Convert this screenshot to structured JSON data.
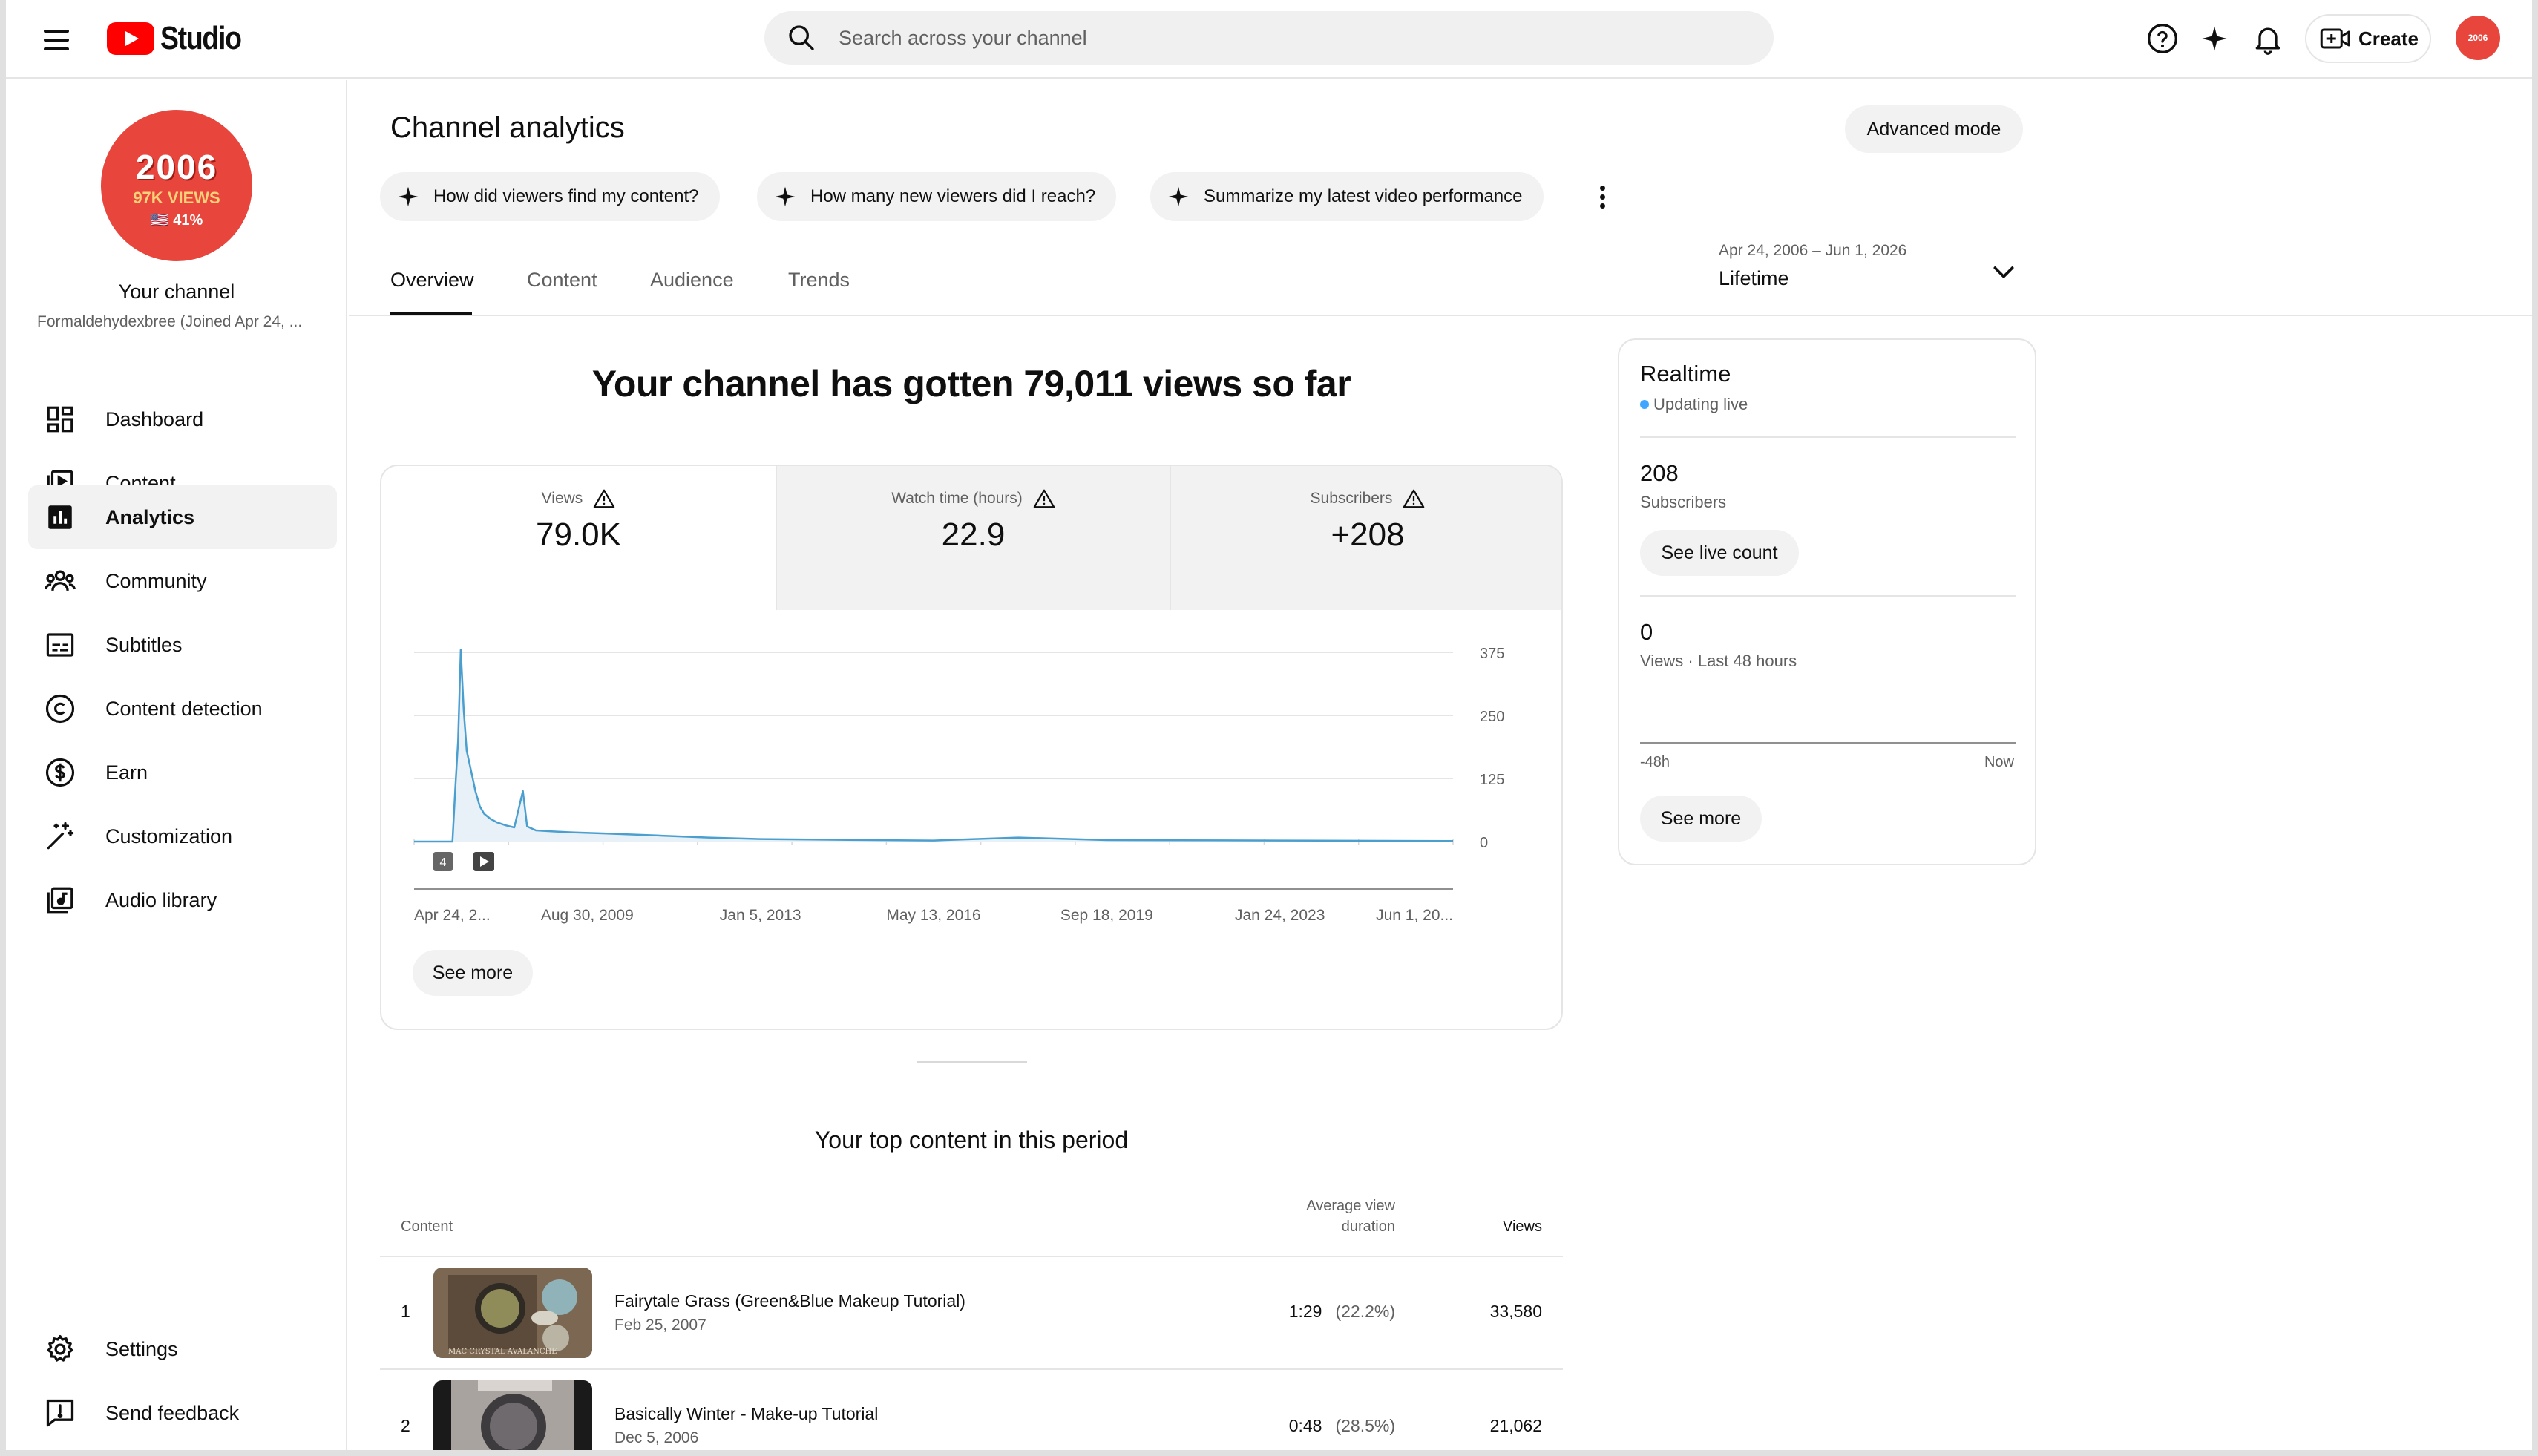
{
  "app": {
    "name": "Studio",
    "avatar_text": "2006"
  },
  "search": {
    "placeholder": "Search across your channel"
  },
  "header": {
    "create_label": "Create"
  },
  "channel": {
    "avatar_year": "2006",
    "avatar_views": "97K VIEWS",
    "avatar_pct": "🇺🇸 41%",
    "name": "Your channel",
    "handle": "Formaldehydexbree (Joined Apr 24, ..."
  },
  "sidebar": {
    "items": [
      {
        "label": "Dashboard",
        "icon": "dashboard-icon"
      },
      {
        "label": "Content",
        "icon": "content-icon"
      },
      {
        "label": "Analytics",
        "icon": "analytics-icon",
        "active": true
      },
      {
        "label": "Community",
        "icon": "community-icon"
      },
      {
        "label": "Subtitles",
        "icon": "subtitles-icon"
      },
      {
        "label": "Content detection",
        "icon": "copyright-icon"
      },
      {
        "label": "Earn",
        "icon": "dollar-icon"
      },
      {
        "label": "Customization",
        "icon": "magic-wand-icon"
      },
      {
        "label": "Audio library",
        "icon": "audio-library-icon"
      }
    ],
    "bottom": [
      {
        "label": "Settings",
        "icon": "gear-icon"
      },
      {
        "label": "Send feedback",
        "icon": "feedback-icon"
      }
    ]
  },
  "main": {
    "title": "Channel analytics",
    "advanced_mode": "Advanced mode",
    "chips": [
      "How did viewers find my content?",
      "How many new viewers did I reach?",
      "Summarize my latest video performance"
    ],
    "tabs": [
      "Overview",
      "Content",
      "Audience",
      "Trends"
    ],
    "date_range": "Apr 24, 2006 – Jun 1, 2026",
    "date_preset": "Lifetime",
    "headline": "Your channel has gotten 79,011 views so far",
    "metrics": [
      {
        "label": "Views",
        "value": "79.0K"
      },
      {
        "label": "Watch time (hours)",
        "value": "22.9"
      },
      {
        "label": "Subscribers",
        "value": "+208"
      }
    ],
    "see_more": "See more",
    "top_content_title": "Your top content in this period",
    "table_headers": {
      "content": "Content",
      "avd_line1": "Average view",
      "avd_line2": "duration",
      "views": "Views"
    },
    "rows": [
      {
        "rank": "1",
        "title": "Fairytale Grass (Green&Blue Makeup Tutorial)",
        "date": "Feb 25, 2007",
        "avd": "1:29",
        "avd_pct": "(22.2%)",
        "views": "33,580",
        "thumb_caption": "MAC CRYSTAL AVALANCHE"
      },
      {
        "rank": "2",
        "title": "Basically Winter - Make-up Tutorial",
        "date": "Dec 5, 2006",
        "avd": "0:48",
        "avd_pct": "(28.5%)",
        "views": "21,062"
      }
    ]
  },
  "chart_data": {
    "type": "area",
    "title": "",
    "x_tick_labels": [
      "Apr 24, 2...",
      "Aug 30, 2009",
      "Jan 5, 2013",
      "May 13, 2016",
      "Sep 18, 2019",
      "Jan 24, 2023",
      "Jun 1, 20..."
    ],
    "y_ticks": [
      0,
      125,
      250,
      375
    ],
    "ylim": [
      0,
      400
    ],
    "x_range": [
      "2006-04-24",
      "2026-06-01"
    ],
    "series": [
      {
        "color": "#4a9fcf",
        "points": [
          [
            "2006-04-24",
            0
          ],
          [
            "2006-12-01",
            0
          ],
          [
            "2007-01-20",
            0
          ],
          [
            "2007-02-10",
            110
          ],
          [
            "2007-03-01",
            200
          ],
          [
            "2007-03-20",
            380
          ],
          [
            "2007-04-10",
            260
          ],
          [
            "2007-05-01",
            180
          ],
          [
            "2007-06-01",
            140
          ],
          [
            "2007-07-01",
            100
          ],
          [
            "2007-08-01",
            70
          ],
          [
            "2007-09-01",
            55
          ],
          [
            "2007-10-15",
            45
          ],
          [
            "2007-12-01",
            38
          ],
          [
            "2008-02-01",
            32
          ],
          [
            "2008-04-01",
            28
          ],
          [
            "2008-06-01",
            100
          ],
          [
            "2008-07-01",
            30
          ],
          [
            "2008-09-01",
            22
          ],
          [
            "2009-01-01",
            20
          ],
          [
            "2009-06-01",
            18
          ],
          [
            "2010-01-01",
            16
          ],
          [
            "2011-01-01",
            12
          ],
          [
            "2012-01-01",
            8
          ],
          [
            "2013-01-05",
            5
          ],
          [
            "2014-01-01",
            4
          ],
          [
            "2016-05-13",
            2
          ],
          [
            "2018-01-01",
            8
          ],
          [
            "2019-09-18",
            3
          ],
          [
            "2023-01-24",
            2
          ],
          [
            "2026-06-01",
            1
          ]
        ]
      }
    ],
    "annotations": [
      "4"
    ],
    "grid": true
  },
  "realtime": {
    "title": "Realtime",
    "status": "Updating live",
    "subscribers_value": "208",
    "subscribers_label": "Subscribers",
    "see_live_count": "See live count",
    "views_value": "0",
    "views_label": "Views · Last 48 hours",
    "axis_start": "-48h",
    "axis_end": "Now",
    "see_more": "See more"
  }
}
